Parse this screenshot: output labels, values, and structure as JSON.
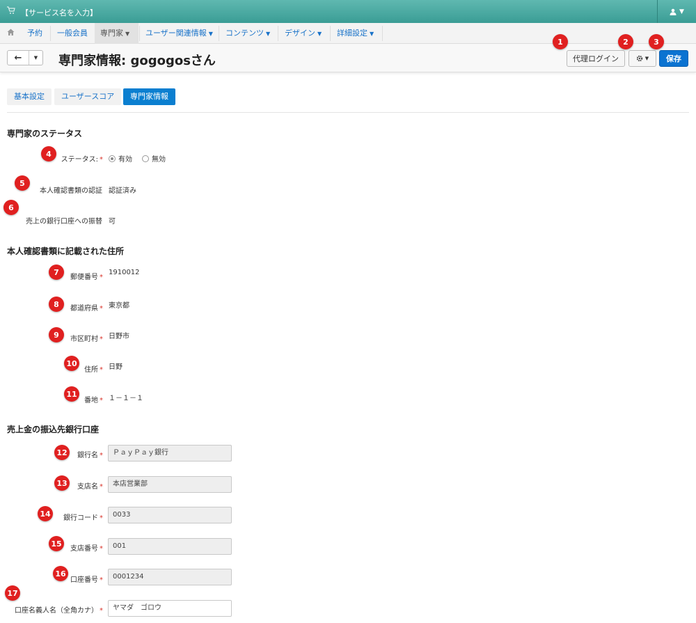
{
  "topbar": {
    "service_name": "【サービス名を入力】",
    "icon": "cart-icon",
    "user_icon": "user-icon"
  },
  "nav": {
    "home_icon": "home-icon",
    "items": [
      {
        "label": "予約",
        "dropdown": false
      },
      {
        "label": "一般会員",
        "dropdown": false
      },
      {
        "label": "専門家",
        "dropdown": true,
        "active": true
      },
      {
        "label": "ユーザー関連情報",
        "dropdown": true
      },
      {
        "label": "コンテンツ",
        "dropdown": true
      },
      {
        "label": "デザイン",
        "dropdown": true
      },
      {
        "label": "詳細設定",
        "dropdown": true
      }
    ]
  },
  "header": {
    "title": "専門家情報: gogogosさん",
    "proxy_login": "代理ログイン",
    "save": "保存"
  },
  "tabs": [
    {
      "label": "基本設定",
      "active": false
    },
    {
      "label": "ユーザースコア",
      "active": false
    },
    {
      "label": "専門家情報",
      "active": true
    }
  ],
  "status_section": {
    "title": "専門家のステータス",
    "status_label": "ステータス:",
    "status_options": [
      "有効",
      "無効"
    ],
    "status_selected": "有効",
    "id_verify_label": "本人確認書類の認証",
    "id_verify_value": "認証済み",
    "transfer_label": "売上の銀行口座への振替",
    "transfer_value": "可"
  },
  "address_section": {
    "title": "本人確認書類に記載された住所",
    "postal_label": "郵便番号",
    "postal_value": "1910012",
    "pref_label": "都道府県",
    "pref_value": "東京都",
    "city_label": "市区町村",
    "city_value": "日野市",
    "addr_label": "住所",
    "addr_value": "日野",
    "block_label": "番地",
    "block_value": "１－１－１"
  },
  "bank_section": {
    "title": "売上金の振込先銀行口座",
    "bank_name_label": "銀行名",
    "bank_name_value": "ＰａｙＰａｙ銀行",
    "branch_name_label": "支店名",
    "branch_name_value": "本店営業部",
    "bank_code_label": "銀行コード",
    "bank_code_value": "0033",
    "branch_no_label": "支店番号",
    "branch_no_value": "001",
    "account_no_label": "口座番号",
    "account_no_value": "0001234",
    "holder_label": "口座名義人名（全角カナ）",
    "holder_value": "ヤマダ　ゴロウ"
  },
  "badges": [
    "1",
    "2",
    "3",
    "4",
    "5",
    "6",
    "7",
    "8",
    "9",
    "10",
    "11",
    "12",
    "13",
    "14",
    "15",
    "16",
    "17"
  ],
  "colors": {
    "accent": "#0b73d1",
    "topbar": "#3a9d95",
    "badge": "#e02020",
    "required": "#d9342b"
  }
}
